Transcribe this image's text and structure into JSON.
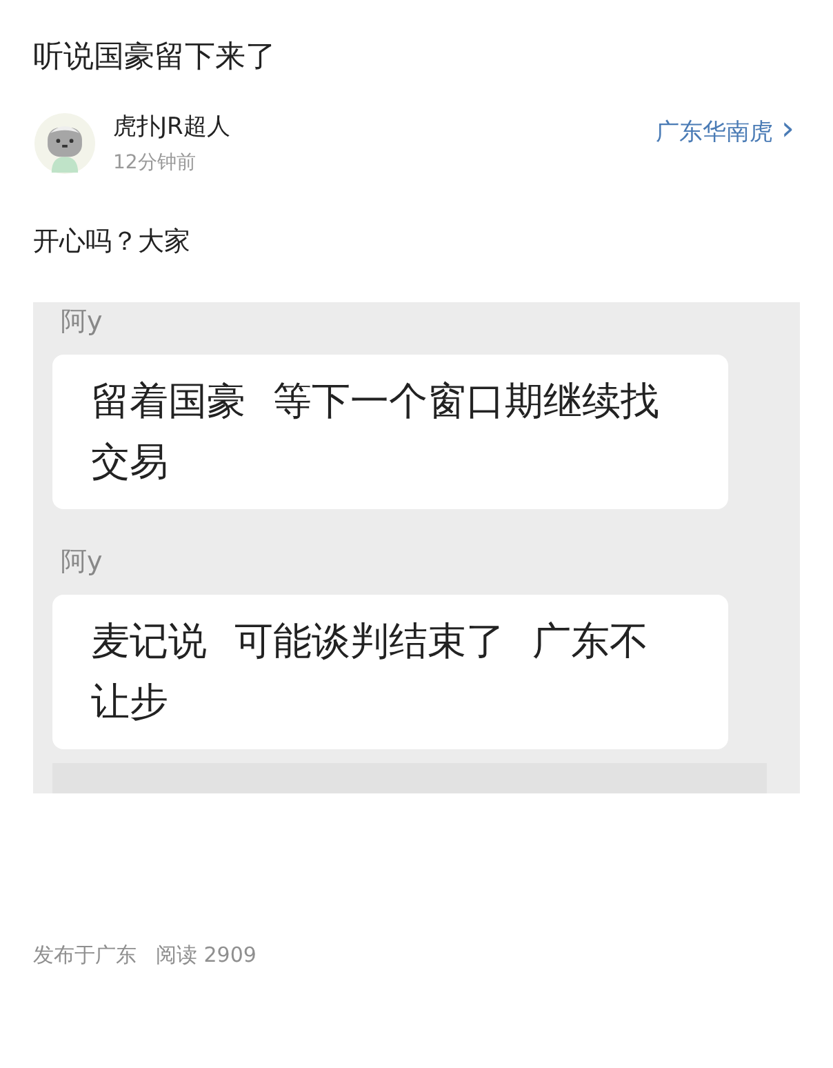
{
  "title": "听说国豪留下来了",
  "author": {
    "name": "虎扑JR超人",
    "time": "12分钟前"
  },
  "forum": {
    "label": "广东华南虎",
    "arrow": "›"
  },
  "body": "开心吗？大家",
  "chat": {
    "messages": [
      {
        "sender": "阿y",
        "text": "留着国豪 等下一个窗口期继续找交易"
      },
      {
        "sender": "阿y",
        "text": "麦记说 可能谈判结束了 广东不让步"
      }
    ]
  },
  "footer": {
    "location": "发布于广东",
    "reads": "阅读 2909"
  }
}
